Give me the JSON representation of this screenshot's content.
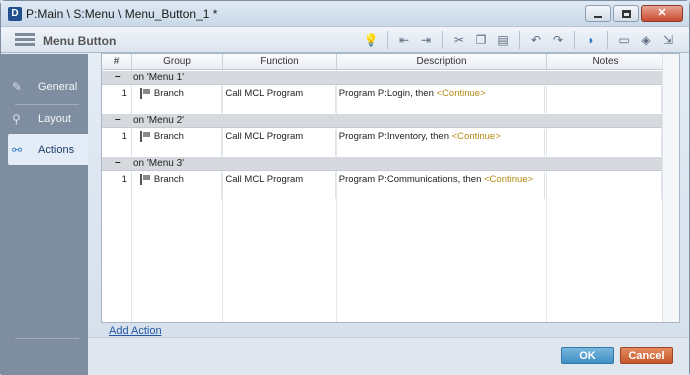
{
  "window": {
    "title": "P:Main \\ S:Menu \\ Menu_Button_1 *",
    "app_icon": "D"
  },
  "toolbar": {
    "title": "Menu Button",
    "icons": [
      "lightbulb-icon",
      "outdent-icon",
      "indent-icon",
      "cut-icon",
      "copy-icon",
      "paste-icon",
      "undo-icon",
      "redo-icon",
      "comment-toggle-icon",
      "comment-icon",
      "tag-icon",
      "export-icon"
    ]
  },
  "sidebar": {
    "items": [
      {
        "label": "General",
        "icon": "general-icon"
      },
      {
        "label": "Layout",
        "icon": "layout-icon"
      },
      {
        "label": "Actions",
        "icon": "actions-icon",
        "active": true
      }
    ]
  },
  "grid": {
    "columns": [
      "#",
      "Group",
      "Function",
      "Description",
      "Notes"
    ],
    "groups": [
      {
        "header": "on 'Menu 1'",
        "rows": [
          {
            "num": "1",
            "group": "Branch",
            "function": "Call MCL Program",
            "description": "Program P:Login, then",
            "continue": "<Continue>",
            "notes": ""
          }
        ]
      },
      {
        "header": "on 'Menu 2'",
        "rows": [
          {
            "num": "1",
            "group": "Branch",
            "function": "Call MCL Program",
            "description": "Program P:Inventory, then",
            "continue": "<Continue>",
            "notes": ""
          }
        ]
      },
      {
        "header": "on 'Menu 3'",
        "rows": [
          {
            "num": "1",
            "group": "Branch",
            "function": "Call MCL Program",
            "description": "Program P:Communications, then",
            "continue": "<Continue>",
            "notes": ""
          }
        ]
      }
    ]
  },
  "add_action_label": "Add Action",
  "footer": {
    "ok_label": "OK",
    "cancel_label": "Cancel"
  }
}
